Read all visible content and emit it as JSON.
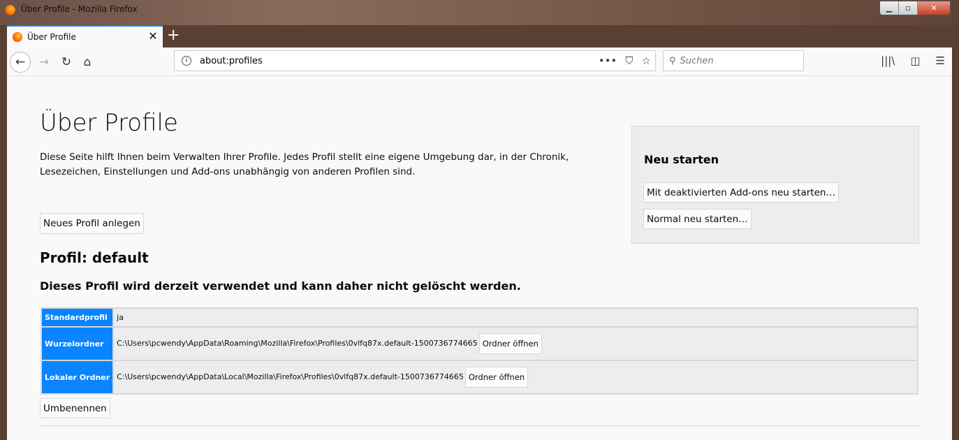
{
  "window": {
    "title": "Über Profile - Mozilla Firefox"
  },
  "tab": {
    "label": "Über Profile"
  },
  "nav": {
    "url": "about:profiles",
    "search_placeholder": "Suchen"
  },
  "page": {
    "title": "Über Profile",
    "intro": "Diese Seite hilft Ihnen beim Verwalten Ihrer Profile. Jedes Profil stellt eine eigene Umgebung dar, in der Chronik, Lesezeichen, Einstellungen und Add-ons unabhängig von anderen Profilen sind.",
    "new_profile_button": "Neues Profil anlegen",
    "profile_heading": "Profil: default",
    "in_use_notice": "Dieses Profil wird derzeit verwendet und kann daher nicht gelöscht werden.",
    "rows": [
      {
        "label": "Standardprofil",
        "value": "ja"
      },
      {
        "label": "Wurzelordner",
        "value": "C:\\Users\\pcwendy\\AppData\\Roaming\\Mozilla\\Firefox\\Profiles\\0vlfq87x.default-1500736774665",
        "button": "Ordner öffnen"
      },
      {
        "label": "Lokaler Ordner",
        "value": "C:\\Users\\pcwendy\\AppData\\Local\\Mozilla\\Firefox\\Profiles\\0vlfq87x.default-1500736774665",
        "button": "Ordner öffnen"
      }
    ],
    "rename_button": "Umbenennen",
    "restart": {
      "heading": "Neu starten",
      "safe_button": "Mit deaktivierten Add-ons neu starten…",
      "normal_button": "Normal neu starten…"
    }
  }
}
